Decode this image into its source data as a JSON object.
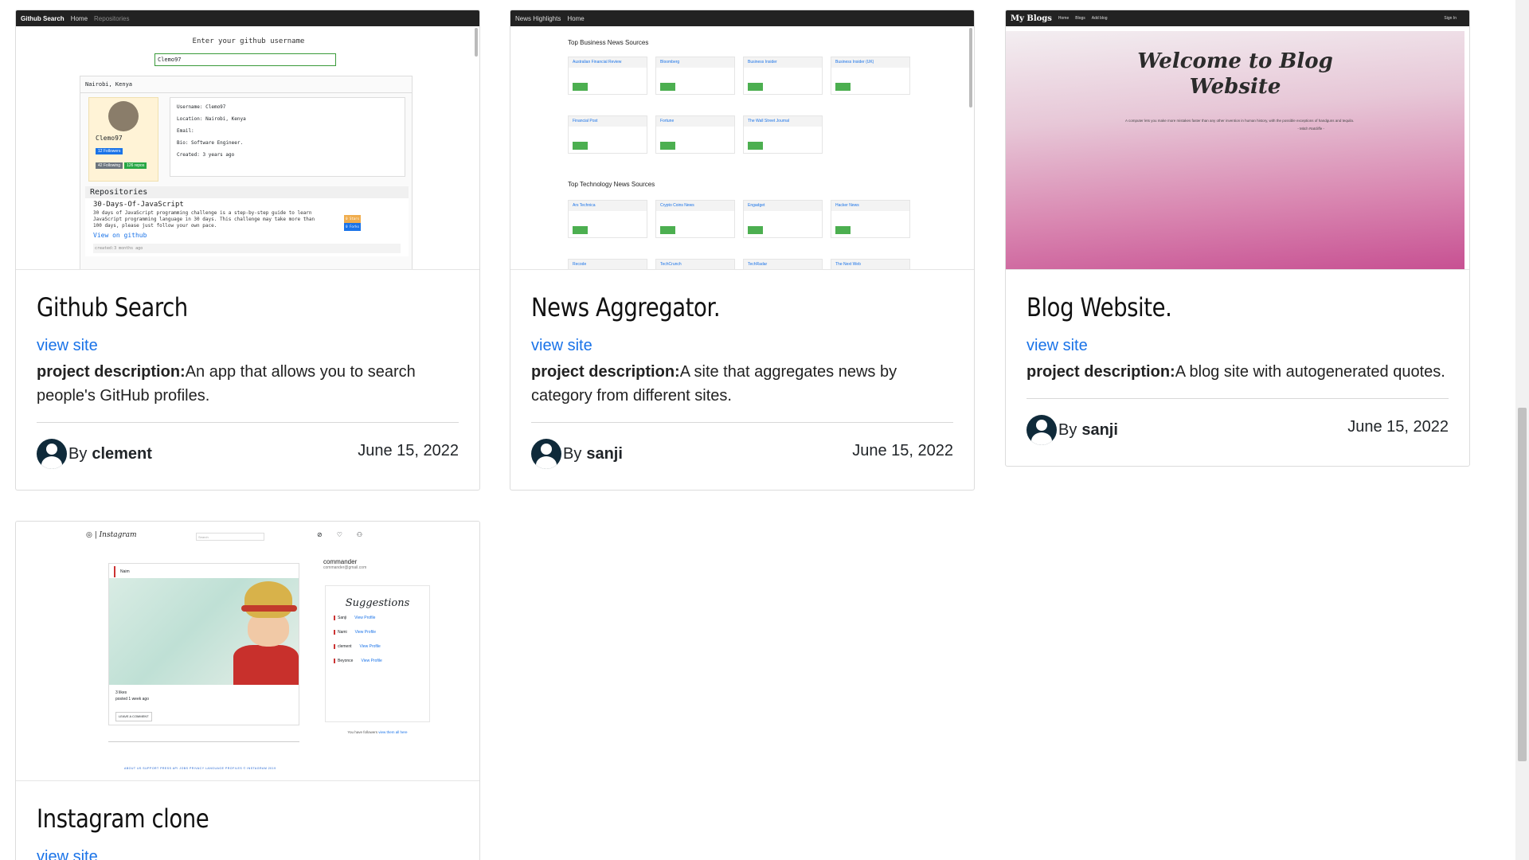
{
  "cards": [
    {
      "title": "Github Search",
      "link_label": "view site",
      "desc_label": "project description:",
      "desc_text": "An app that allows you to search people's GitHub profiles.",
      "by_label": "By",
      "author": "clement",
      "date": "June 15, 2022",
      "preview": {
        "nav_brand": "Github Search",
        "nav_home": "Home",
        "nav_repos": "Repositories",
        "prompt": "Enter your github username",
        "input_value": "Clemo97",
        "location": "Nairobi, Kenya",
        "username": "Clemo97",
        "followers": "12 Followers",
        "following": "42 Following",
        "repos_badge": "126 repos",
        "info_username": "Username: Clemo97",
        "info_location": "Location: Nairobi, Kenya",
        "info_email": "Email:",
        "info_bio": "Bio: Software Engineer.",
        "info_created": "Created: 3 years ago",
        "repos_heading": "Repositories",
        "repo_name": "30-Days-Of-JavaScript",
        "repo_desc": "30 days of JavaScript programming challenge is a step-by-step guide to learn JavaScript programming language in 30 days. This challenge may take more than 100 days, please just follow your own pace.",
        "repo_link": "View on github",
        "repo_created": "created:3 months ago",
        "repo_stars": "0 Stars",
        "repo_forks": "0 Forks"
      }
    },
    {
      "title": "News Aggregator.",
      "link_label": "view site",
      "desc_label": "project description:",
      "desc_text": "A site that aggregates news by category from different sites.",
      "by_label": "By",
      "author": "sanji",
      "date": "June 15, 2022",
      "preview": {
        "nav_brand": "News Highlights",
        "nav_home": "Home",
        "section1": "Top Business News Sources",
        "section2": "Top Technology News Sources",
        "business": [
          "Australian Financial Review",
          "Bloomberg",
          "Business Insider",
          "Business Insider (UK)",
          "Financial Post",
          "Fortune",
          "The Wall Street Journal"
        ],
        "tech": [
          "Ars Technica",
          "Crypto Coins News",
          "Engadget",
          "Hacker News",
          "Recode",
          "TechCrunch",
          "TechRadar",
          "The Next Web"
        ]
      }
    },
    {
      "title": "Blog Website.",
      "link_label": "view site",
      "desc_label": "project description:",
      "desc_text": "A blog site with autogenerated quotes.",
      "by_label": "By",
      "author": "sanji",
      "date": "June 15, 2022",
      "preview": {
        "nav_brand": "My Blogs",
        "nav_items": [
          "Home",
          "Blogs",
          "Add blog"
        ],
        "nav_signin": "Sign In",
        "hero_line1": "Welcome to Blog",
        "hero_line2": "Website",
        "quote": "A computer lets you make more mistakes faster than any other invention in human history, with the possible exceptions of handguns and tequila.",
        "quote_author": "- Mitch Ratcliffe -"
      }
    },
    {
      "title": "Instagram clone",
      "link_label": "view site",
      "preview": {
        "brand": "Instagram",
        "search_placeholder": "Search",
        "post_user": "Naim",
        "post_likes": "3 likes",
        "post_time": "posted 1 week ago",
        "comment_btn": "LEAVE A COMMENT",
        "profile_name": "commander",
        "profile_email": "commander@gmail.com",
        "suggestions_title": "Suggestions",
        "suggestions": [
          {
            "name": "Sanji",
            "link": "View Profile"
          },
          {
            "name": "Nami",
            "link": "View Profile"
          },
          {
            "name": "clement",
            "link": "View Profile"
          },
          {
            "name": "Beyonce",
            "link": "View Profile"
          }
        ],
        "followers_note": "You have followers",
        "followers_link": "view them all here",
        "footer_links": "ABOUT US   SUPPORT   PRESS   API   JOBS   PRIVACY   LANGUAGE   PROFILES   © INSTAGRAM 2019"
      }
    }
  ]
}
